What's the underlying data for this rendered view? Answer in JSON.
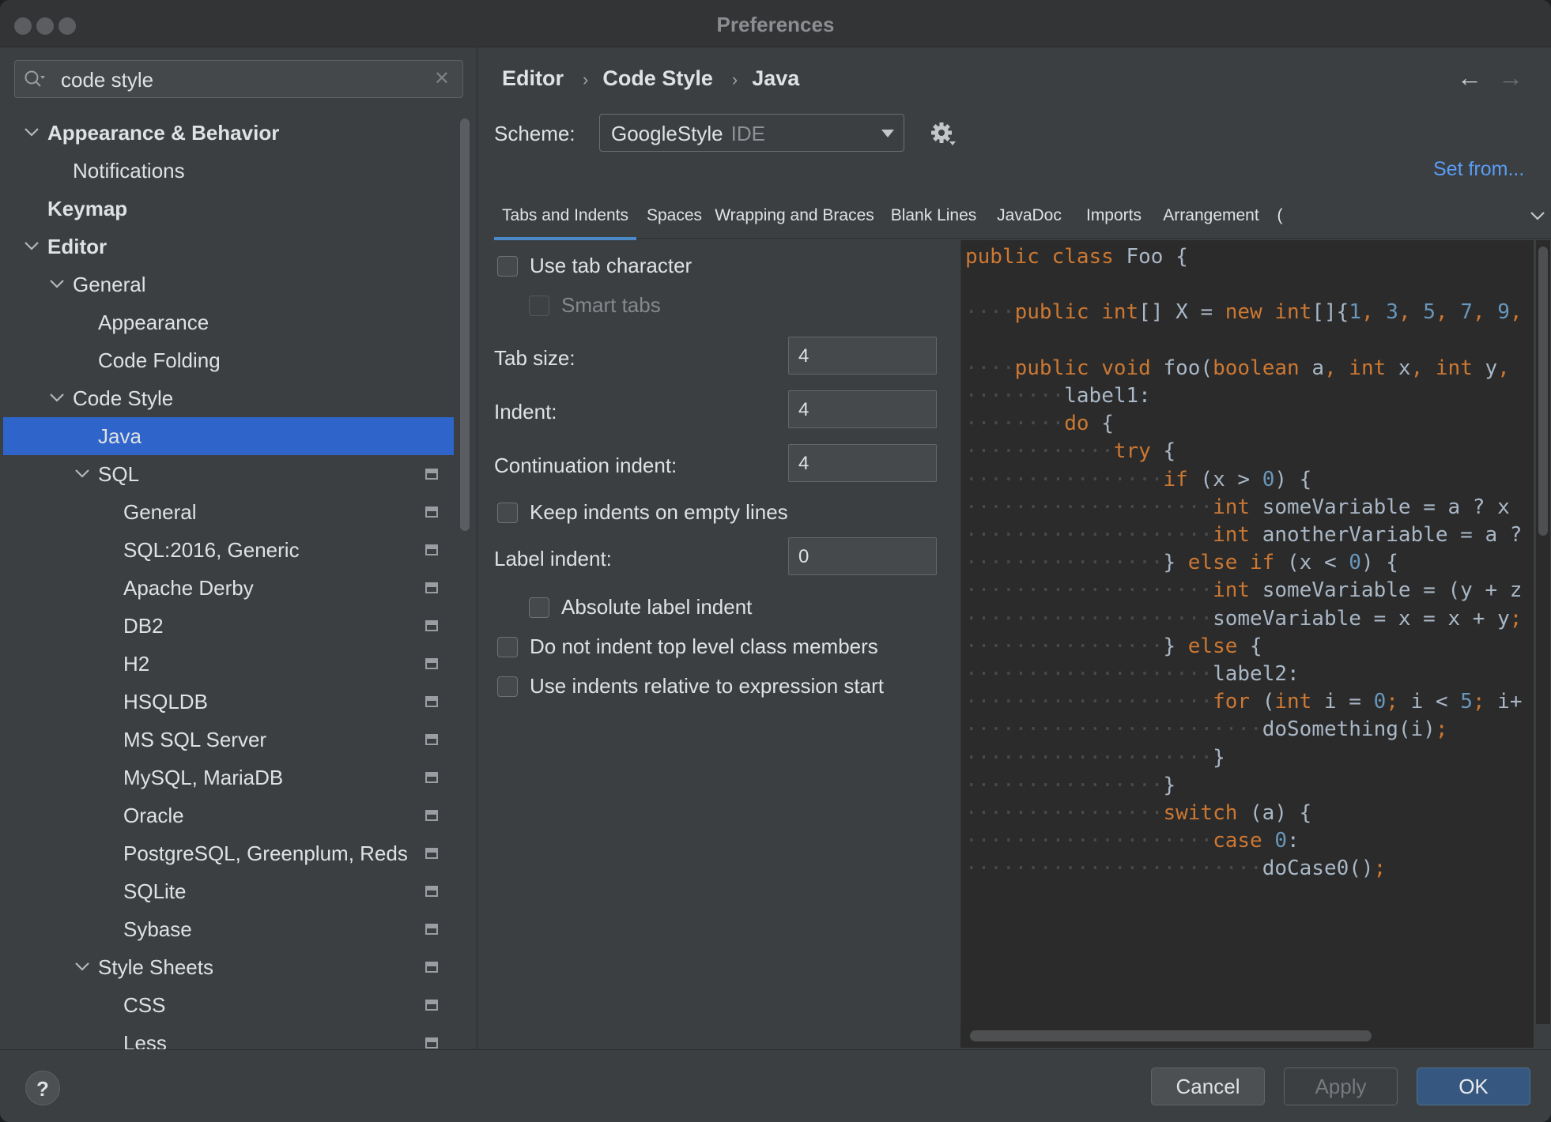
{
  "window": {
    "title": "Preferences"
  },
  "search": {
    "value": "code style"
  },
  "tree": [
    {
      "label": "Appearance & Behavior",
      "bold": true,
      "expanded": true,
      "level": 0,
      "project": false
    },
    {
      "label": "Notifications",
      "bold": false,
      "level": 1,
      "project": false
    },
    {
      "label": "Keymap",
      "bold": true,
      "level": 0,
      "project": false
    },
    {
      "label": "Editor",
      "bold": true,
      "expanded": true,
      "level": 0,
      "project": false
    },
    {
      "label": "General",
      "bold": false,
      "expanded": true,
      "level": 1,
      "project": false
    },
    {
      "label": "Appearance",
      "bold": false,
      "level": 2,
      "project": false
    },
    {
      "label": "Code Folding",
      "bold": false,
      "level": 2,
      "project": false
    },
    {
      "label": "Code Style",
      "bold": false,
      "expanded": true,
      "level": 1,
      "project": false
    },
    {
      "label": "Java",
      "bold": false,
      "level": 2,
      "selected": true,
      "project": false
    },
    {
      "label": "SQL",
      "bold": false,
      "expanded": true,
      "level": 2,
      "project": true
    },
    {
      "label": "General",
      "bold": false,
      "level": 3,
      "project": true
    },
    {
      "label": "SQL:2016, Generic",
      "bold": false,
      "level": 3,
      "project": true
    },
    {
      "label": "Apache Derby",
      "bold": false,
      "level": 3,
      "project": true
    },
    {
      "label": "DB2",
      "bold": false,
      "level": 3,
      "project": true
    },
    {
      "label": "H2",
      "bold": false,
      "level": 3,
      "project": true
    },
    {
      "label": "HSQLDB",
      "bold": false,
      "level": 3,
      "project": true
    },
    {
      "label": "MS SQL Server",
      "bold": false,
      "level": 3,
      "project": true
    },
    {
      "label": "MySQL, MariaDB",
      "bold": false,
      "level": 3,
      "project": true
    },
    {
      "label": "Oracle",
      "bold": false,
      "level": 3,
      "project": true
    },
    {
      "label": "PostgreSQL, Greenplum, Reds",
      "bold": false,
      "level": 3,
      "project": true
    },
    {
      "label": "SQLite",
      "bold": false,
      "level": 3,
      "project": true
    },
    {
      "label": "Sybase",
      "bold": false,
      "level": 3,
      "project": true
    },
    {
      "label": "Style Sheets",
      "bold": false,
      "expanded": true,
      "level": 2,
      "project": true
    },
    {
      "label": "CSS",
      "bold": false,
      "level": 3,
      "project": true
    },
    {
      "label": "Less",
      "bold": false,
      "level": 3,
      "project": true
    }
  ],
  "breadcrumb": [
    "Editor",
    "Code Style",
    "Java"
  ],
  "scheme": {
    "label": "Scheme:",
    "value": "GoogleStyle",
    "scope": "IDE",
    "set_from": "Set from..."
  },
  "tabs": [
    "Tabs and Indents",
    "Spaces",
    "Wrapping and Braces",
    "Blank Lines",
    "JavaDoc",
    "Imports",
    "Arrangement",
    "("
  ],
  "active_tab": 0,
  "options": {
    "use_tab_character": {
      "label": "Use tab character",
      "checked": false
    },
    "smart_tabs": {
      "label": "Smart tabs",
      "checked": false,
      "disabled": true
    },
    "tab_size": {
      "label": "Tab size:",
      "value": "4"
    },
    "indent": {
      "label": "Indent:",
      "value": "4"
    },
    "continuation_indent": {
      "label": "Continuation indent:",
      "value": "4"
    },
    "keep_indents": {
      "label": "Keep indents on empty lines",
      "checked": false
    },
    "label_indent": {
      "label": "Label indent:",
      "value": "0"
    },
    "absolute_label_indent": {
      "label": "Absolute label indent",
      "checked": false
    },
    "no_indent_top_level": {
      "label": "Do not indent top level class members",
      "checked": false
    },
    "indents_relative": {
      "label": "Use indents relative to expression start",
      "checked": false
    }
  },
  "code_preview": [
    {
      "indent": 0,
      "tokens": [
        [
          "kw",
          "public class "
        ],
        [
          "p",
          "Foo {"
        ]
      ]
    },
    {
      "indent": 0,
      "tokens": []
    },
    {
      "indent": 1,
      "tokens": [
        [
          "kw",
          "public "
        ],
        [
          "kw",
          "int"
        ],
        [
          "p",
          "[] X = "
        ],
        [
          "kw",
          "new "
        ],
        [
          "kw",
          "int"
        ],
        [
          "p",
          "[]{"
        ],
        [
          "num",
          "1"
        ],
        [
          "kw",
          ", "
        ],
        [
          "num",
          "3"
        ],
        [
          "kw",
          ", "
        ],
        [
          "num",
          "5"
        ],
        [
          "kw",
          ", "
        ],
        [
          "num",
          "7"
        ],
        [
          "kw",
          ", "
        ],
        [
          "num",
          "9"
        ],
        [
          "kw",
          ","
        ]
      ]
    },
    {
      "indent": 0,
      "tokens": []
    },
    {
      "indent": 1,
      "tokens": [
        [
          "kw",
          "public void "
        ],
        [
          "p",
          "foo("
        ],
        [
          "kw",
          "boolean "
        ],
        [
          "p",
          "a"
        ],
        [
          "kw",
          ", "
        ],
        [
          "kw",
          "int "
        ],
        [
          "p",
          "x"
        ],
        [
          "kw",
          ", "
        ],
        [
          "kw",
          "int "
        ],
        [
          "p",
          "y"
        ],
        [
          "kw",
          ","
        ]
      ]
    },
    {
      "indent": 2,
      "tokens": [
        [
          "p",
          "label1:"
        ]
      ]
    },
    {
      "indent": 2,
      "tokens": [
        [
          "kw",
          "do "
        ],
        [
          "p",
          "{"
        ]
      ]
    },
    {
      "indent": 3,
      "tokens": [
        [
          "kw",
          "try "
        ],
        [
          "p",
          "{"
        ]
      ]
    },
    {
      "indent": 4,
      "tokens": [
        [
          "kw",
          "if "
        ],
        [
          "p",
          "(x > "
        ],
        [
          "num",
          "0"
        ],
        [
          "p",
          ") {"
        ]
      ]
    },
    {
      "indent": 5,
      "tokens": [
        [
          "kw",
          "int "
        ],
        [
          "p",
          "someVariable = a ? x"
        ]
      ]
    },
    {
      "indent": 5,
      "tokens": [
        [
          "kw",
          "int "
        ],
        [
          "p",
          "anotherVariable = a ?"
        ]
      ]
    },
    {
      "indent": 4,
      "tokens": [
        [
          "p",
          "} "
        ],
        [
          "kw",
          "else if "
        ],
        [
          "p",
          "(x < "
        ],
        [
          "num",
          "0"
        ],
        [
          "p",
          ") {"
        ]
      ]
    },
    {
      "indent": 5,
      "tokens": [
        [
          "kw",
          "int "
        ],
        [
          "p",
          "someVariable = (y + z"
        ]
      ]
    },
    {
      "indent": 5,
      "tokens": [
        [
          "p",
          "someVariable = x = x + y"
        ],
        [
          "kw",
          ";"
        ]
      ]
    },
    {
      "indent": 4,
      "tokens": [
        [
          "p",
          "} "
        ],
        [
          "kw",
          "else "
        ],
        [
          "p",
          "{"
        ]
      ]
    },
    {
      "indent": 5,
      "tokens": [
        [
          "p",
          "label2:"
        ]
      ]
    },
    {
      "indent": 5,
      "tokens": [
        [
          "kw",
          "for "
        ],
        [
          "p",
          "("
        ],
        [
          "kw",
          "int "
        ],
        [
          "p",
          "i = "
        ],
        [
          "num",
          "0"
        ],
        [
          "kw",
          "; "
        ],
        [
          "p",
          "i < "
        ],
        [
          "num",
          "5"
        ],
        [
          "kw",
          "; "
        ],
        [
          "p",
          "i+"
        ]
      ]
    },
    {
      "indent": 6,
      "tokens": [
        [
          "p",
          "doSomething(i)"
        ],
        [
          "kw",
          ";"
        ]
      ]
    },
    {
      "indent": 5,
      "tokens": [
        [
          "p",
          "}"
        ]
      ]
    },
    {
      "indent": 4,
      "tokens": [
        [
          "p",
          "}"
        ]
      ]
    },
    {
      "indent": 4,
      "tokens": [
        [
          "kw",
          "switch "
        ],
        [
          "p",
          "(a) {"
        ]
      ]
    },
    {
      "indent": 5,
      "tokens": [
        [
          "kw",
          "case "
        ],
        [
          "num",
          "0"
        ],
        [
          "p",
          ":"
        ]
      ]
    },
    {
      "indent": 6,
      "tokens": [
        [
          "p",
          "doCase0()"
        ],
        [
          "kw",
          ";"
        ]
      ]
    }
  ],
  "footer": {
    "help": "?",
    "cancel": "Cancel",
    "apply": "Apply",
    "ok": "OK"
  },
  "colors": {
    "selection": "#2f65ca",
    "link": "#589df6",
    "keyword": "#cc7832",
    "number": "#6897bb",
    "code_bg": "#2b2b2b"
  }
}
